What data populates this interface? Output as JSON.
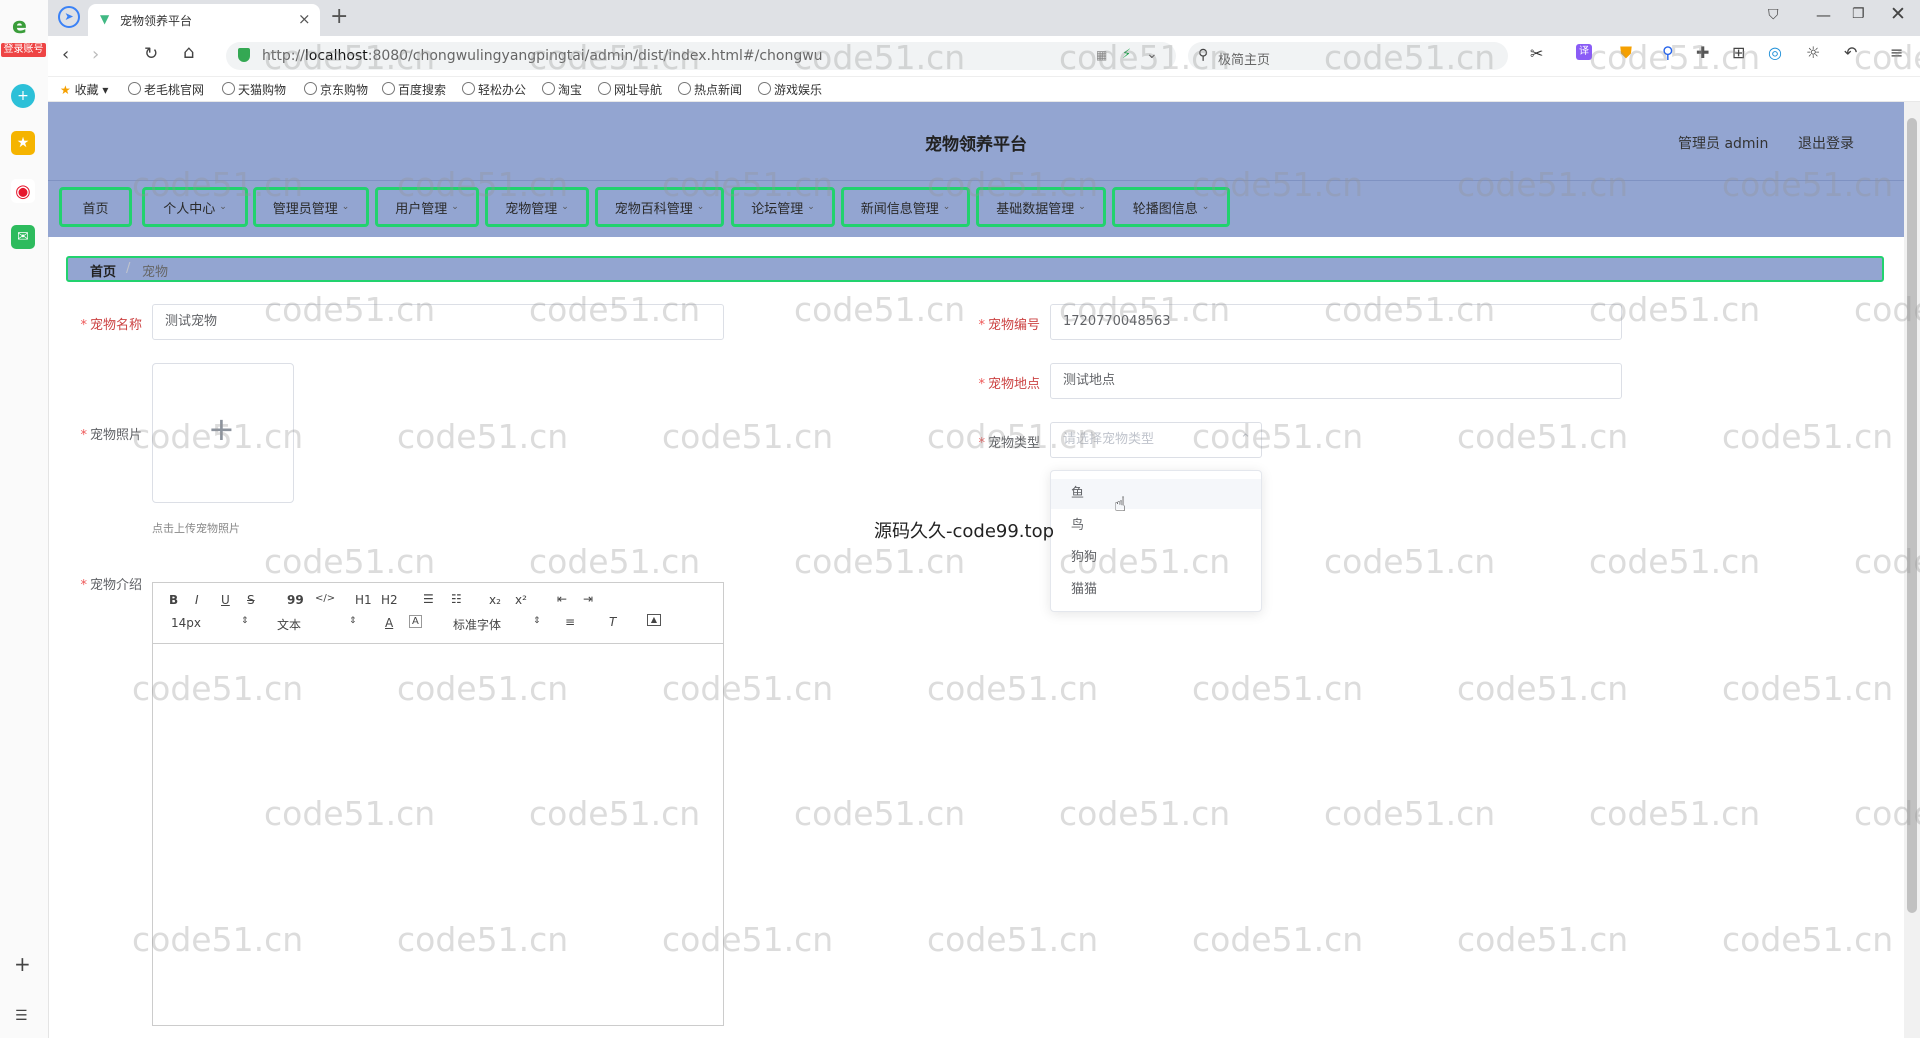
{
  "browser": {
    "side_badge": "登录账号",
    "tab_title": "宠物领养平台",
    "url_prefix": "http://",
    "url_host": "localhost",
    "url_rest": ":8080/chongwulingyangpingtai/admin/dist/index.html#/chongwu",
    "search_placeholder": "极简主页",
    "bookmarks": [
      "收藏",
      "老毛桃官网",
      "天猫购物",
      "京东购物",
      "百度搜索",
      "轻松办公",
      "淘宝",
      "网址导航",
      "热点新闻",
      "游戏娱乐"
    ]
  },
  "app": {
    "title": "宠物领养平台",
    "user_label": "管理员 admin",
    "logout": "退出登录",
    "nav": [
      {
        "label": "首页",
        "caret": ""
      },
      {
        "label": "个人中心",
        "caret": "⌄"
      },
      {
        "label": "管理员管理",
        "caret": "⌄"
      },
      {
        "label": "用户管理",
        "caret": "⌄"
      },
      {
        "label": "宠物管理",
        "caret": "⌄"
      },
      {
        "label": "宠物百科管理",
        "caret": "⌄"
      },
      {
        "label": "论坛管理",
        "caret": "⌄"
      },
      {
        "label": "新闻信息管理",
        "caret": "⌄"
      },
      {
        "label": "基础数据管理",
        "caret": "⌄"
      },
      {
        "label": "轮播图信息",
        "caret": "⌄"
      }
    ],
    "breadcrumb": {
      "home": "首页",
      "sep": "/",
      "current": "宠物"
    }
  },
  "form": {
    "required_mark": "*",
    "name_label": "宠物名称",
    "name_value": "测试宠物",
    "code_label": "宠物编号",
    "code_value": "1720770048563",
    "location_label": "宠物地点",
    "location_value": "测试地点",
    "photo_label": "宠物照片",
    "photo_plus": "+",
    "photo_hint": "点击上传宠物照片",
    "type_label": "宠物类型",
    "type_placeholder": "请选择宠物类型",
    "type_options": [
      "鱼",
      "鸟",
      "狗狗",
      "猫猫"
    ],
    "intro_label": "宠物介绍",
    "editor": {
      "bold": "B",
      "italic": "I",
      "underline": "U",
      "strike": "S",
      "quote": "99",
      "code": "</>",
      "h1": "H1",
      "h2": "H2",
      "sub": "x₂",
      "sup": "x²",
      "size": "14px",
      "block": "文本",
      "font": "标准字体"
    }
  },
  "overlay_text": "源码久久-code99.top",
  "watermark": "code51.cn"
}
